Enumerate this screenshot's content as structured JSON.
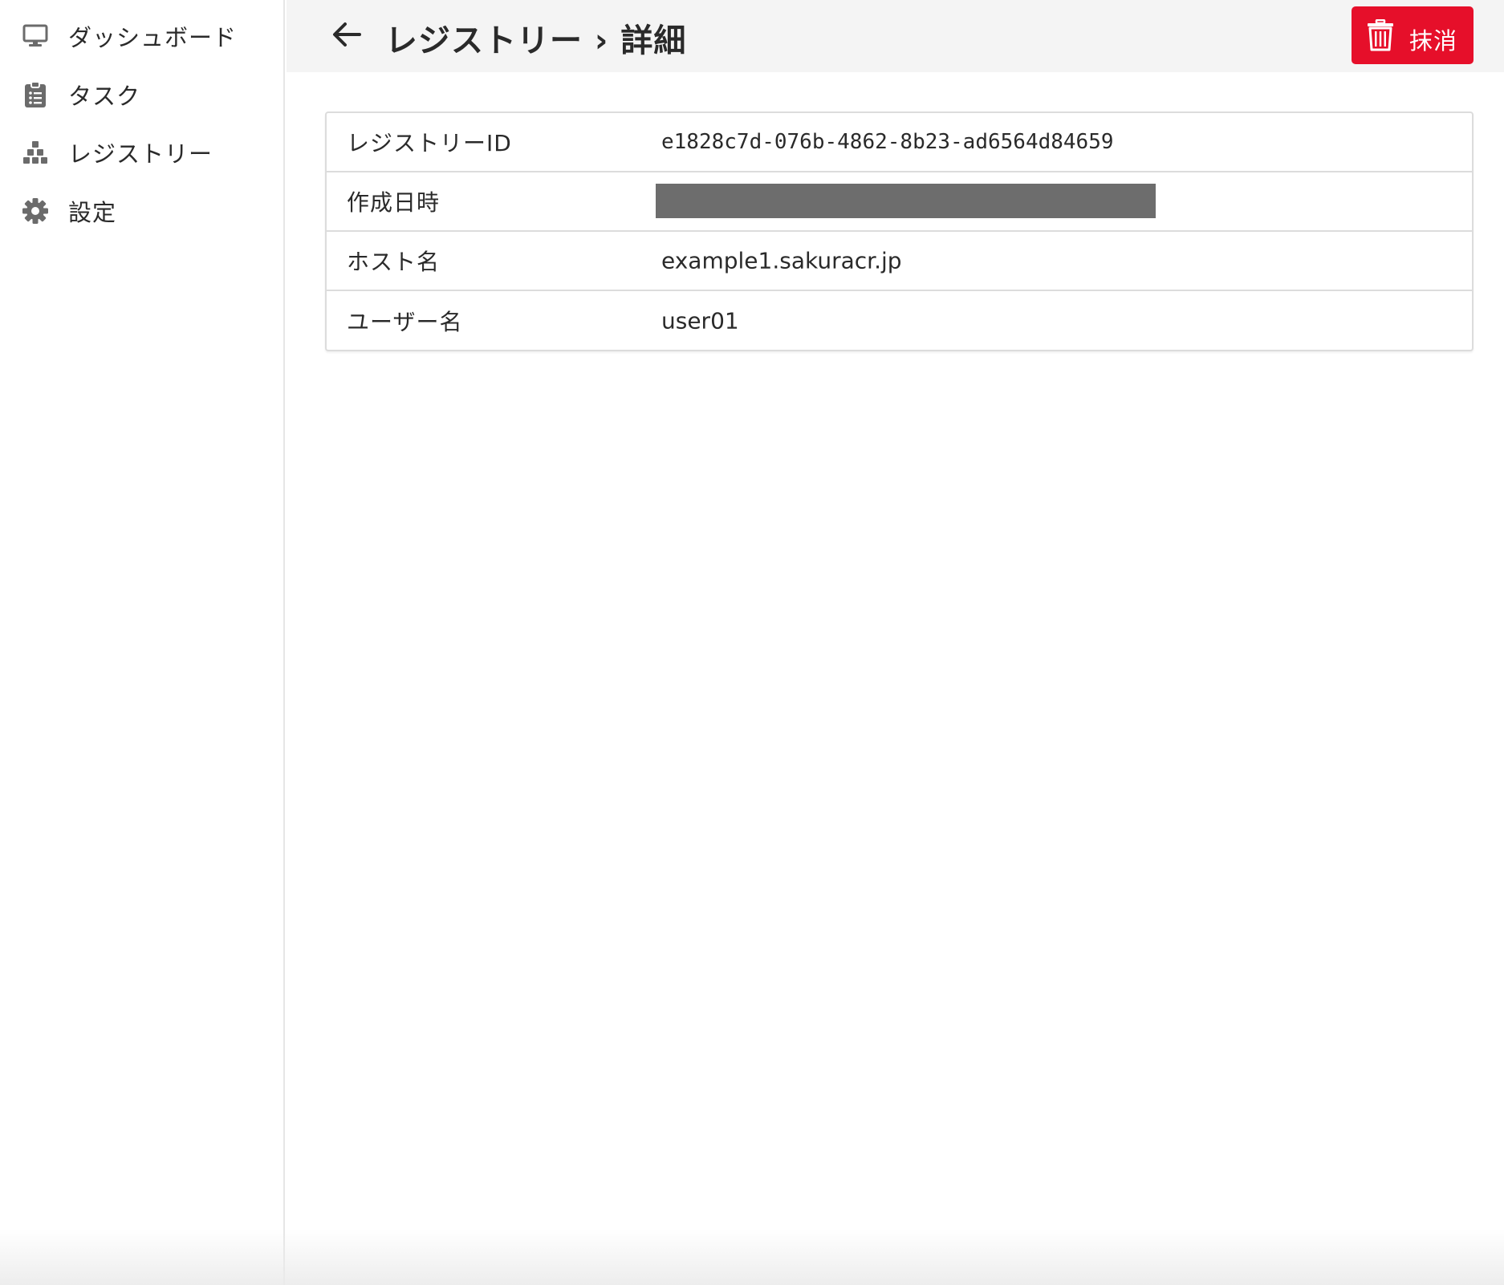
{
  "sidebar": {
    "items": [
      {
        "label": "ダッシュボード",
        "icon": "monitor-icon"
      },
      {
        "label": "タスク",
        "icon": "clipboard-icon"
      },
      {
        "label": "レジストリー",
        "icon": "registry-icon"
      },
      {
        "label": "設定",
        "icon": "gear-icon"
      }
    ]
  },
  "header": {
    "title": "レジストリー › 詳細",
    "back_icon": "arrow-left-icon",
    "delete_button": {
      "label": "抹消",
      "icon": "trash-icon",
      "color": "#e60f2a"
    }
  },
  "details": {
    "rows": [
      {
        "key": "レジストリーID",
        "value": "e1828c7d-076b-4862-8b23-ad6564d84659"
      },
      {
        "key": "作成日時",
        "value": ""
      },
      {
        "key": "ホスト名",
        "value": "example1.sakuracr.jp"
      },
      {
        "key": "ユーザー名",
        "value": "user01"
      }
    ]
  },
  "colors": {
    "accent_danger": "#e60f2a",
    "header_bg": "#f4f4f4",
    "redaction": "#6d6d6d"
  }
}
